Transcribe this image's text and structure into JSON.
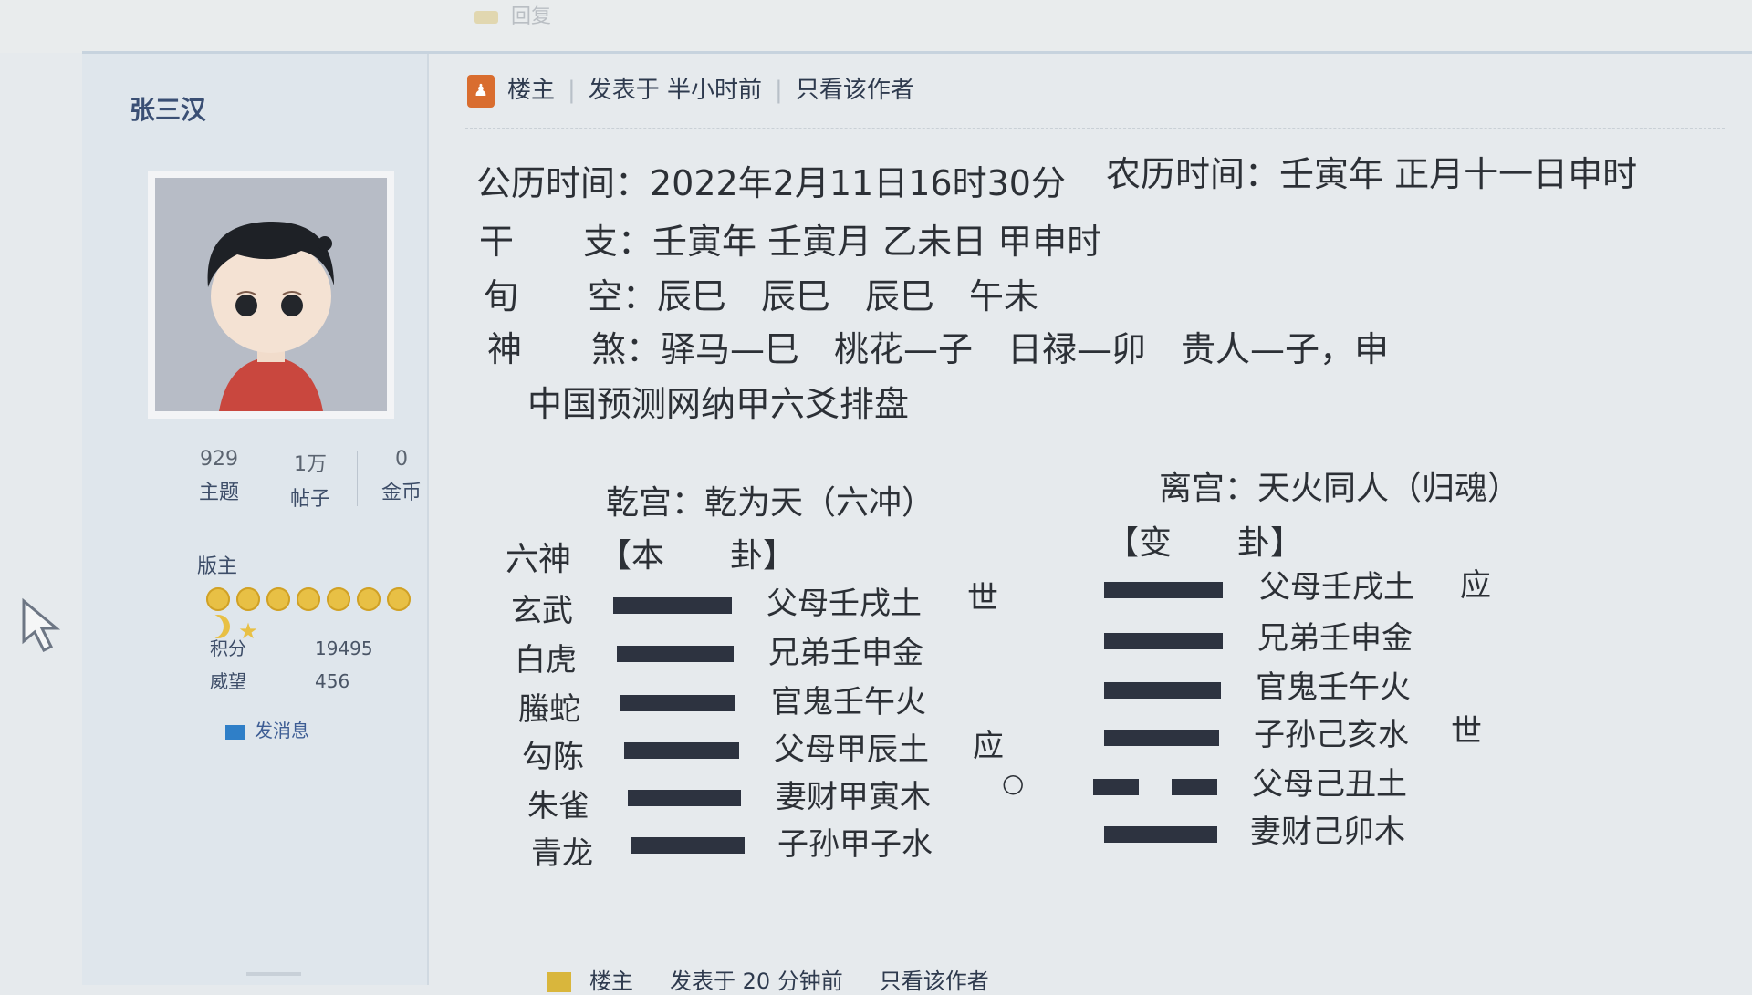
{
  "top_tab": "回复",
  "sidebar": {
    "username": "张三汉",
    "stats": [
      {
        "value": "929",
        "label": "主题"
      },
      {
        "value": "1万",
        "label": "帖子"
      },
      {
        "value": "0",
        "label": "金币"
      }
    ],
    "rank": "版主",
    "points_label": "积分",
    "points_value": "19495",
    "prestige_label": "威望",
    "prestige_value": "456",
    "send_message": "发消息"
  },
  "post_header": {
    "owner": "楼主",
    "posted": "发表于 半小时前",
    "only_author": "只看该作者"
  },
  "info": {
    "solar": "公历时间：2022年2月11日16时30分",
    "lunar": "农历时间：壬寅年 正月十一日申时",
    "ganzhi_label": "干　　支：",
    "ganzhi": "壬寅年 壬寅月 乙未日 甲申时",
    "xunkong_label": "旬　　空：",
    "xunkong": "辰巳　辰巳　辰巳　午未",
    "shensha_label": "神　　煞：",
    "shensha": "驿马—巳　桃花—子　日禄—卯　贵人—子，申",
    "source": "中国预测网纳甲六爻排盘"
  },
  "hexagram": {
    "main_title": "乾宫：乾为天（六冲）",
    "changed_title": "离宫：天火同人（归魂）",
    "liushen_head": "六神",
    "main_head": "【本　　卦】",
    "changed_head": "【变　　卦】",
    "rows": [
      {
        "shen": "玄武",
        "main": "父母壬戌土",
        "main_mark": "世",
        "moving": "",
        "changed": "父母壬戌土",
        "changed_mark": "应",
        "main_yin": false,
        "changed_yin": false
      },
      {
        "shen": "白虎",
        "main": "兄弟壬申金",
        "main_mark": "",
        "moving": "",
        "changed": "兄弟壬申金",
        "changed_mark": "",
        "main_yin": false,
        "changed_yin": false
      },
      {
        "shen": "螣蛇",
        "main": "官鬼壬午火",
        "main_mark": "",
        "moving": "",
        "changed": "官鬼壬午火",
        "changed_mark": "",
        "main_yin": false,
        "changed_yin": false
      },
      {
        "shen": "勾陈",
        "main": "父母甲辰土",
        "main_mark": "应",
        "moving": "",
        "changed": "子孙己亥水",
        "changed_mark": "世",
        "main_yin": false,
        "changed_yin": false
      },
      {
        "shen": "朱雀",
        "main": "妻财甲寅木",
        "main_mark": "",
        "moving": "○",
        "changed": "父母己丑土",
        "changed_mark": "",
        "main_yin": false,
        "changed_yin": true
      },
      {
        "shen": "青龙",
        "main": "子孙甲子水",
        "main_mark": "",
        "moving": "",
        "changed": "妻财己卯木",
        "changed_mark": "",
        "main_yin": false,
        "changed_yin": false
      }
    ]
  },
  "bottom_header": {
    "owner": "楼主",
    "posted": "发表于 20 分钟前",
    "only_author": "只看该作者"
  }
}
